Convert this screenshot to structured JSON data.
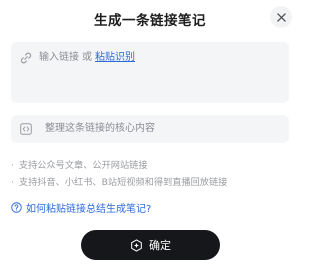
{
  "dialog": {
    "title": "生成一条链接笔记"
  },
  "link_input": {
    "placeholder": "输入链接",
    "or_text": "或",
    "paste_label": "粘贴识别"
  },
  "note_input": {
    "placeholder": "整理这条链接的核心内容"
  },
  "tips": [
    {
      "bullet": "·",
      "text": "支持公众号文章、公开网站链接"
    },
    {
      "bullet": "·",
      "text": "支持抖音、小红书、B站短视频和得到直播回放链接"
    }
  ],
  "help": {
    "label": "如何粘贴链接总结生成笔记?"
  },
  "confirm": {
    "label": "确定"
  },
  "icons": {
    "close": "close-icon",
    "link": "link-icon",
    "note": "code-bracket-icon",
    "help": "help-circle-icon",
    "confirm": "sparkle-hex-icon"
  },
  "colors": {
    "accent_link": "#2f6bd8",
    "button_bg": "#16171b",
    "input_bg": "#f4f5f7",
    "placeholder": "#8a8d93",
    "tip_text": "#9a9ca1"
  }
}
